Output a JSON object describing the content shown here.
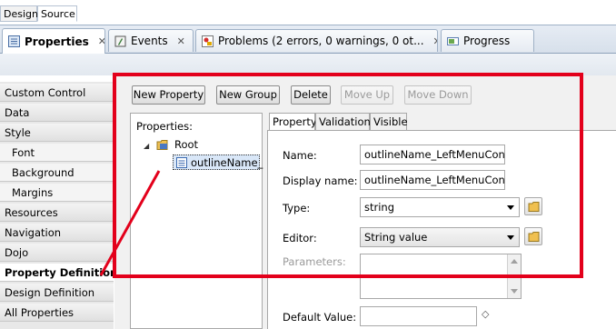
{
  "editor_tabs": [
    "Design",
    "Source"
  ],
  "view_tabs": [
    {
      "label": "Properties",
      "close": "✕"
    },
    {
      "label": "Events",
      "close": "✕"
    },
    {
      "label": "Problems (2 errors, 0 warnings, 0 ot...",
      "close": "✕"
    },
    {
      "label": "Progress",
      "close": ""
    }
  ],
  "left_nav": {
    "items": [
      "Custom Control",
      "Data",
      "Style",
      "Font",
      "Background",
      "Margins",
      "Resources",
      "Navigation",
      "Dojo",
      "Property Definition",
      "Design Definition",
      "All Properties"
    ],
    "selected": "Property Definition"
  },
  "toolbar": {
    "new_property": "New Property",
    "new_group": "New Group",
    "delete": "Delete",
    "move_up": "Move Up",
    "move_down": "Move Down"
  },
  "tree": {
    "header": "Properties:",
    "root": "Root",
    "child": "outlineName_"
  },
  "property_tabs": [
    "Property",
    "Validation",
    "Visible"
  ],
  "form": {
    "name_label": "Name:",
    "name_value": "outlineName_LeftMenuConti",
    "display_name_label": "Display name:",
    "display_name_value": "outlineName_LeftMenuConti",
    "type_label": "Type:",
    "type_value": "string",
    "editor_label": "Editor:",
    "editor_value": "String value",
    "parameters_label": "Parameters:",
    "default_value_label": "Default Value:",
    "default_value": "",
    "diamond": "◇"
  },
  "colors": {
    "annotation_red": "#e3001b"
  }
}
